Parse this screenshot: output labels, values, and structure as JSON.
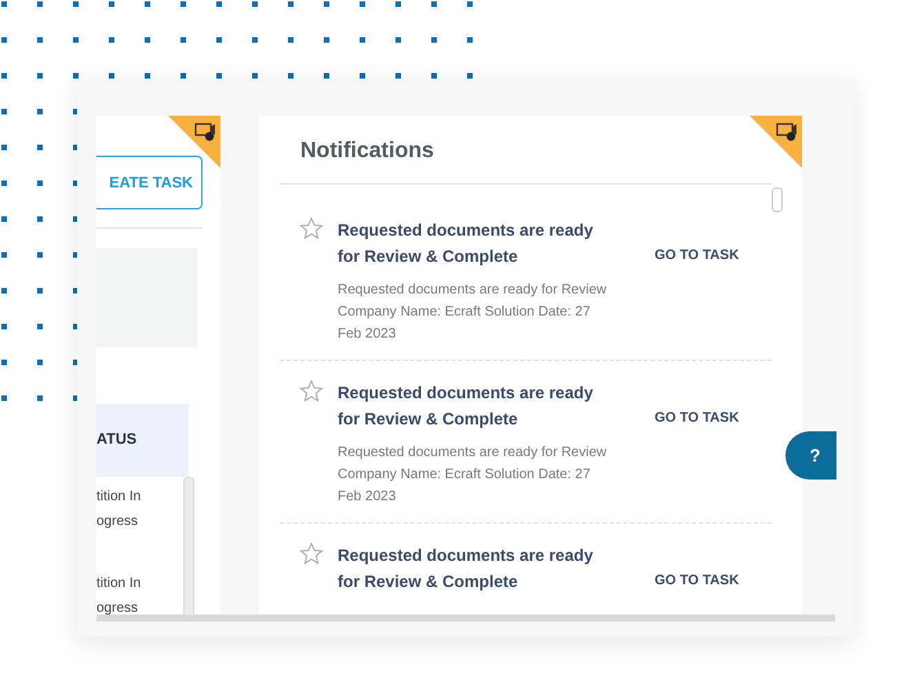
{
  "left_panel": {
    "create_button": "EATE TASK",
    "table": {
      "header": "ATUS",
      "rows": [
        "tition In\nogress",
        "tition In\nogress"
      ]
    }
  },
  "notifications": {
    "title": "Notifications",
    "items": [
      {
        "starred": false,
        "title": "Requested documents are ready for Review & Complete",
        "description": "Requested documents are ready for Review Company Name: Ecraft Solution Date: 27 Feb 2023",
        "action": "GO TO TASK"
      },
      {
        "starred": false,
        "title": "Requested documents are ready for Review & Complete",
        "description": "Requested documents are ready for Review Company Name: Ecraft Solution Date: 27 Feb 2023",
        "action": "GO TO TASK"
      },
      {
        "starred": false,
        "title": "Requested documents are ready for Review & Complete",
        "action": "GO TO TASK"
      }
    ]
  },
  "help_button": "?"
}
